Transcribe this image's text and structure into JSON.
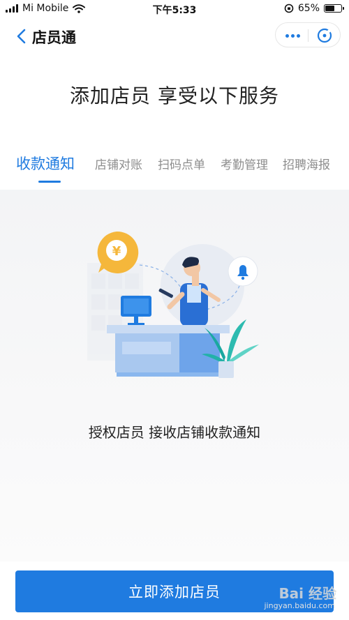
{
  "status_bar": {
    "carrier": "Mi Mobile",
    "time": "下午5:33",
    "battery": "65%",
    "battery_level": 0.65,
    "icons": [
      "signal-icon",
      "wifi-icon",
      "orientation-lock-icon",
      "battery-icon"
    ]
  },
  "nav": {
    "title": "店员通",
    "icons": [
      "back-icon",
      "more-icon",
      "close-icon"
    ]
  },
  "headline": "添加店员 享受以下服务",
  "tabs": [
    {
      "label": "收款通知",
      "active": true
    },
    {
      "label": "店铺对账",
      "active": false
    },
    {
      "label": "扫码点单",
      "active": false
    },
    {
      "label": "考勤管理",
      "active": false
    },
    {
      "label": "招聘海报",
      "active": false
    }
  ],
  "illustration": {
    "coin_symbol": "¥",
    "icons": [
      "yuan-coin-icon",
      "bell-icon",
      "cash-register-icon",
      "plant-icon"
    ]
  },
  "caption": "授权店员 接收店铺收款通知",
  "cta_button": "立即添加店员",
  "watermark": {
    "text": "Bai 经验",
    "sub": "jingyan.baidu.com"
  },
  "colors": {
    "accent": "#1f7be0",
    "coin": "#f5b73b",
    "plant": "#2dbbb0"
  }
}
